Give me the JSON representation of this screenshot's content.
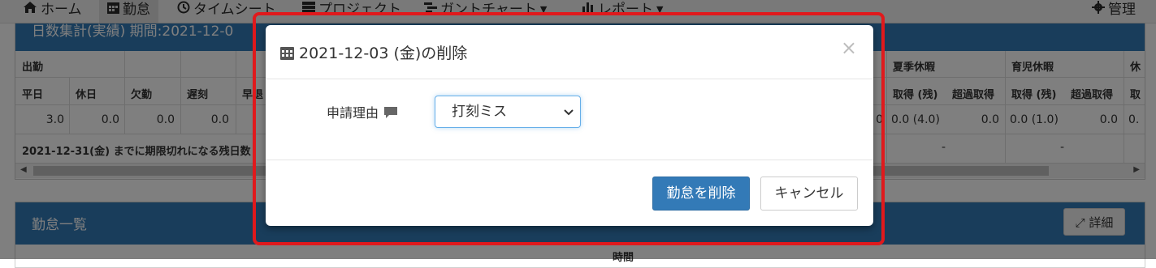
{
  "nav": {
    "home": "ホーム",
    "attendance": "勤怠",
    "timesheet": "タイムシート",
    "project": "プロジェクト",
    "gantt": "ガントチャート",
    "report": "レポート",
    "admin": "管理"
  },
  "summary": {
    "title": "日数集計(実績) 期間:2021-12-0",
    "headers": {
      "attend": "出勤",
      "weekday": "平日",
      "holiday": "休日",
      "absence": "欠勤",
      "late": "遅刻",
      "early": "早退",
      "summer": "夏季休暇",
      "childcare": "育児休暇",
      "rest": "休",
      "acquired_remaining": "取得 (残)",
      "over_acquired": "超過取得",
      "acq_short": "取"
    },
    "values": {
      "weekday": "3.0",
      "holiday": "0.0",
      "absence": "0.0",
      "late": "0.0",
      "col_before_summer": "0",
      "summer_acquired": "0.0 (4.0)",
      "summer_over": "0.0",
      "child_acquired": "0.0 (1.0)",
      "child_over": "0.0",
      "rest_partial": "0."
    },
    "expiry_note": "2021-12-31(金) までに期限切れになる残日数",
    "dash": "-"
  },
  "attendance_list": {
    "title": "勤怠一覧",
    "detail_button": "詳細",
    "time_header": "時間"
  },
  "modal": {
    "title": "2021-12-03 (金)の削除",
    "close": "×",
    "field_label": "申請理由",
    "selected_reason": "打刻ミス",
    "delete_button": "勤怠を削除",
    "cancel_button": "キャンセル"
  },
  "colors": {
    "primary": "#337ab7",
    "highlight": "#e0191c"
  }
}
